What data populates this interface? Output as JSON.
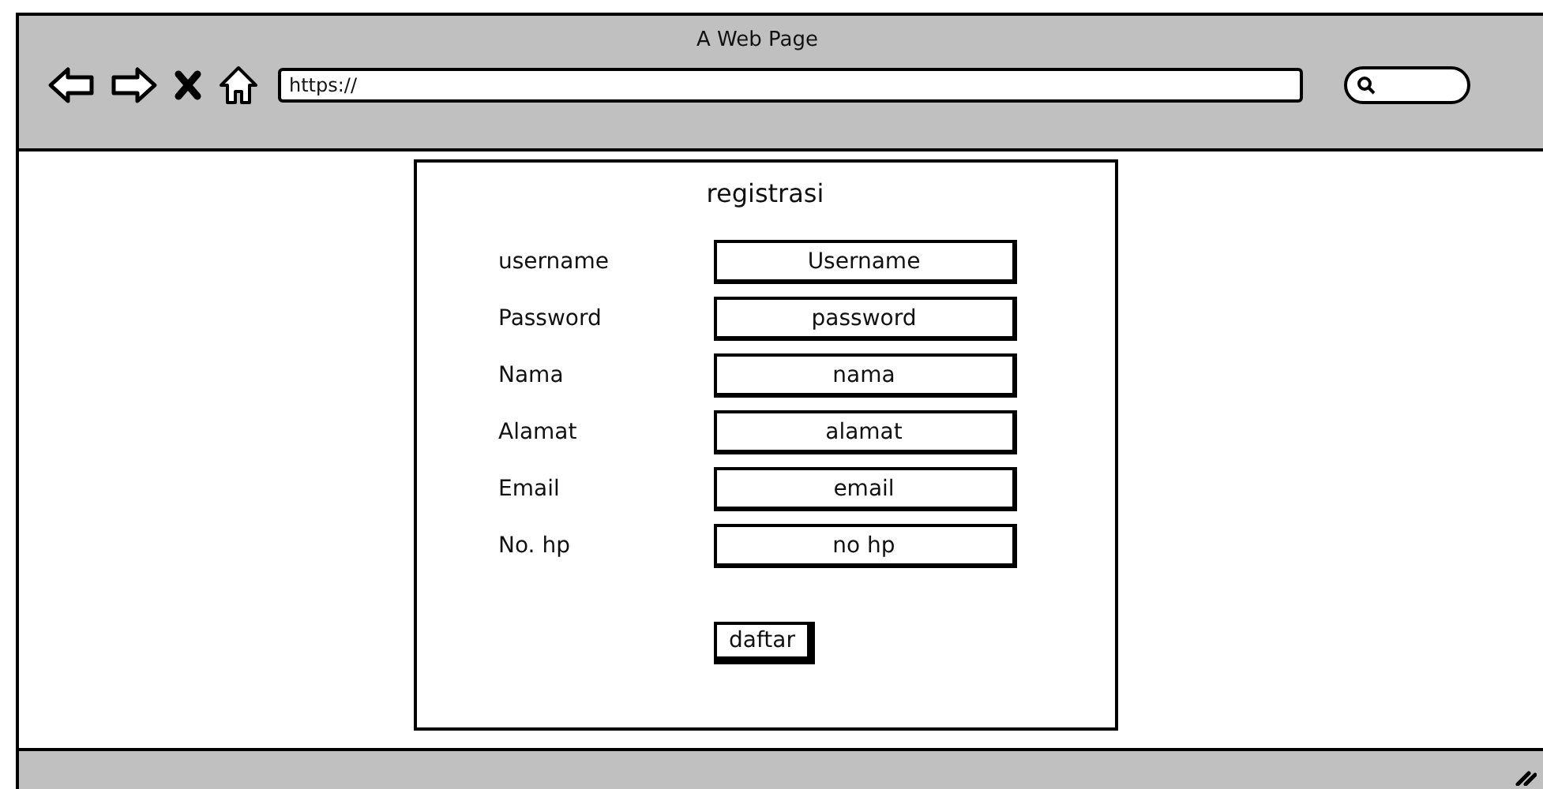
{
  "window": {
    "title": "A Web Page"
  },
  "address_bar": {
    "value": "https://"
  },
  "form": {
    "title": "registrasi",
    "fields": [
      {
        "label": "username",
        "value": "Username"
      },
      {
        "label": "Password",
        "value": "password"
      },
      {
        "label": "Nama",
        "value": "nama"
      },
      {
        "label": "Alamat",
        "value": "alamat"
      },
      {
        "label": "Email",
        "value": "email"
      },
      {
        "label": "No. hp",
        "value": "no hp"
      }
    ],
    "button": "daftar"
  }
}
